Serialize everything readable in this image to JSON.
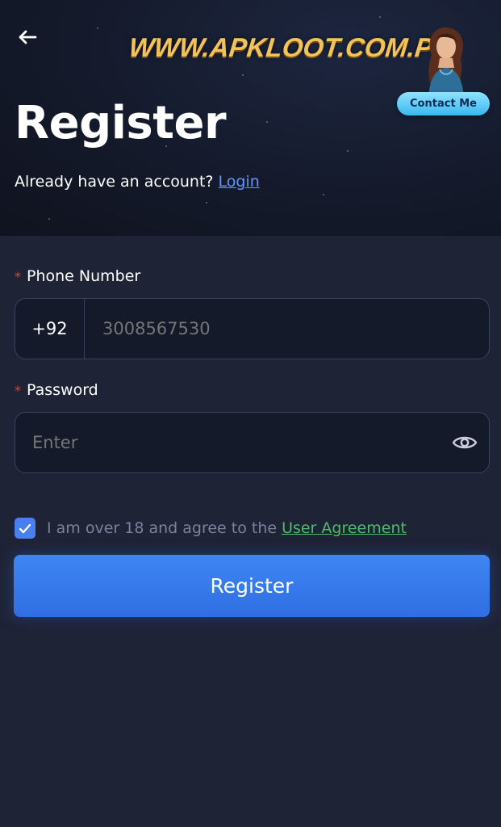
{
  "header": {
    "watermark": "WWW.APKLOOT.COM.PK",
    "contact_label": "Contact Me",
    "title": "Register",
    "account_prompt": "Already have an account?",
    "login_link": "Login"
  },
  "form": {
    "phone": {
      "label": "Phone Number",
      "required_mark": "*",
      "country_code": "+92",
      "placeholder": "3008567530"
    },
    "password": {
      "label": "Password",
      "required_mark": "*",
      "placeholder": "Enter"
    },
    "agreement": {
      "checked": true,
      "text": "I am over 18 and agree to the",
      "link": "User Agreement"
    },
    "submit_label": "Register"
  },
  "colors": {
    "accent": "#3f86f4",
    "link": "#5f96ff",
    "agreement_link": "#4dbd6a",
    "required": "#e8413c",
    "contact_button": "#38b8f0"
  }
}
